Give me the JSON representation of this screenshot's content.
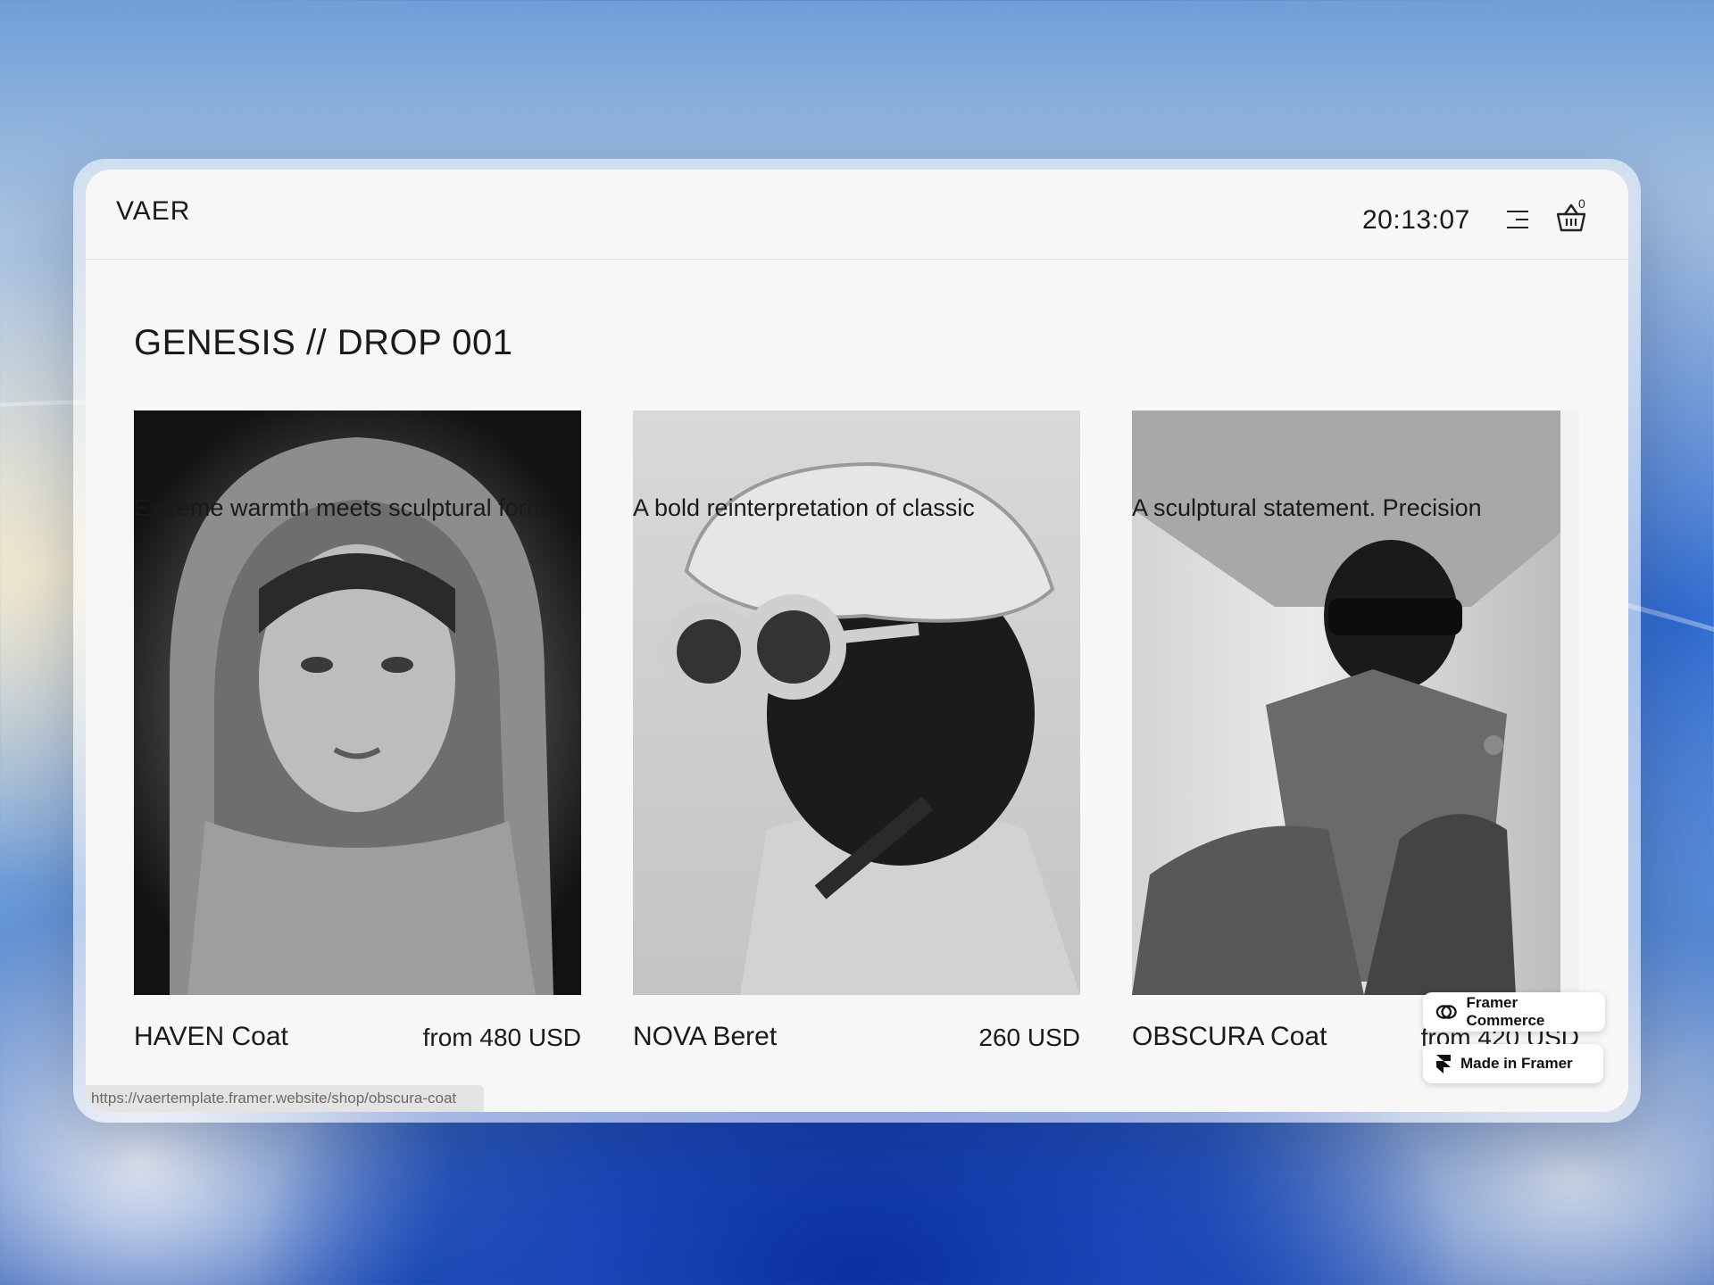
{
  "header": {
    "logo": "VAER",
    "clock": "20:13:07",
    "cart_count": "0"
  },
  "collection": {
    "title": "GENESIS // DROP 001"
  },
  "products": [
    {
      "name": "HAVEN Coat",
      "price": "from 480 USD",
      "description": "Extreme warmth meets sculptural form."
    },
    {
      "name": "NOVA Beret",
      "price": "260 USD",
      "description": "A bold reinterpretation of classic"
    },
    {
      "name": "OBSCURA Coat",
      "price": "from 420 USD",
      "description": "A sculptural statement. Precision"
    }
  ],
  "badges": {
    "framer_commerce": "Framer Commerce",
    "made_in_framer": "Made in Framer"
  },
  "status_bar": {
    "url": "https://vaertemplate.framer.website/shop/obscura-coat"
  }
}
